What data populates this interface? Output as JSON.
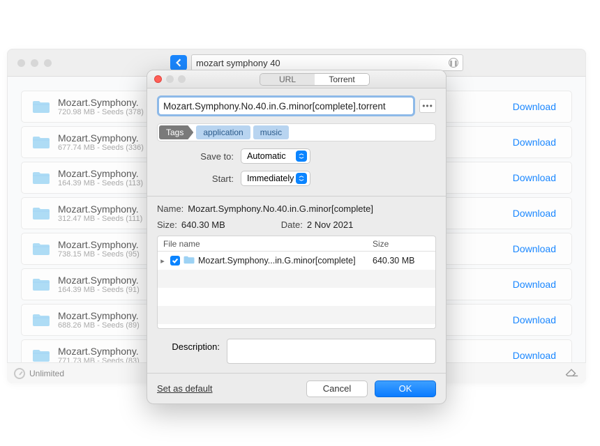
{
  "background": {
    "search_value": "mozart symphony 40",
    "download_label": "Download",
    "footer_text": "Unlimited",
    "results": [
      {
        "title": "Mozart.Symphony.",
        "sub": "720.98 MB - Seeds (378)"
      },
      {
        "title": "Mozart.Symphony.",
        "sub": "677.74 MB - Seeds (336)"
      },
      {
        "title": "Mozart.Symphony.",
        "sub": "164.39 MB - Seeds (113)"
      },
      {
        "title": "Mozart.Symphony.",
        "sub": "312.47 MB - Seeds (111)"
      },
      {
        "title": "Mozart.Symphony.",
        "sub": "738.15 MB - Seeds (95)"
      },
      {
        "title": "Mozart.Symphony.",
        "sub": "164.39 MB - Seeds (91)"
      },
      {
        "title": "Mozart.Symphony.",
        "sub": "688.26 MB - Seeds (89)"
      },
      {
        "title": "Mozart.Symphony.",
        "sub": "771.73 MB - Seeds (83)"
      }
    ]
  },
  "modal": {
    "tabs": {
      "url": "URL",
      "torrent": "Torrent"
    },
    "filename": "Mozart.Symphony.No.40.in.G.minor[complete].torrent",
    "tags_label": "Tags",
    "tags": [
      "application",
      "music"
    ],
    "saveto_label": "Save to:",
    "saveto_value": "Automatic",
    "start_label": "Start:",
    "start_value": "Immediately",
    "name_label": "Name:",
    "name_value": "Mozart.Symphony.No.40.in.G.minor[complete]",
    "size_label": "Size:",
    "size_value": "640.30 MB",
    "date_label": "Date:",
    "date_value": "2 Nov 2021",
    "table_head_file": "File name",
    "table_head_size": "Size",
    "file_row_name": "Mozart.Symphony...in.G.minor[complete]",
    "file_row_size": "640.30 MB",
    "desc_label": "Description:",
    "set_default": "Set as default",
    "cancel": "Cancel",
    "ok": "OK"
  }
}
